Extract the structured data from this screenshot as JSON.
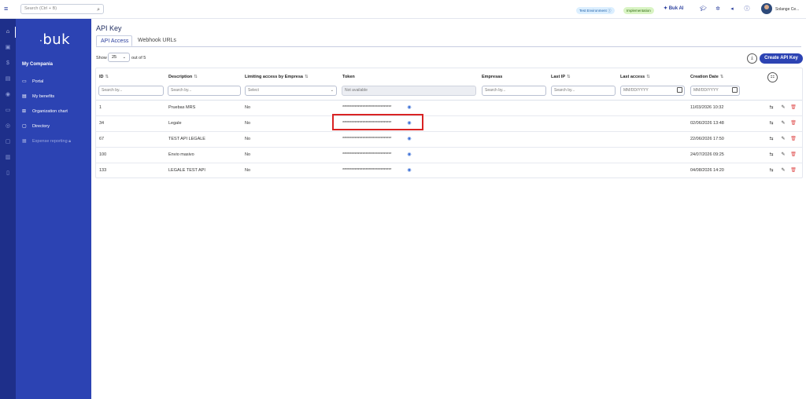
{
  "topbar": {
    "search_placeholder": "Search (Ctrl + B)",
    "env_badge": "Test Environment ⓘ",
    "impl_badge": "Implementation",
    "buk_ai": "✦ Buk AI",
    "user_name": "Solange Ce..."
  },
  "sidebar": {
    "logo": "buk",
    "company": "My Compania",
    "items": [
      {
        "label": "Portal",
        "icon": "monitor-icon"
      },
      {
        "label": "My benefits",
        "icon": "gift-icon"
      },
      {
        "label": "Organization chart",
        "icon": "org-chart-icon"
      },
      {
        "label": "Directory",
        "icon": "briefcase-icon"
      },
      {
        "label": "Expense reporting",
        "icon": "receipt-icon"
      }
    ]
  },
  "page": {
    "title": "API Key",
    "tabs": [
      "API Access",
      "Webhook URLs"
    ],
    "show_label": "Show",
    "show_value": "25",
    "out_of": "out of 5",
    "create_button": "Create API Key"
  },
  "table": {
    "headers": {
      "id": "ID",
      "description": "Description",
      "limiting": "Limiting access by Empresa",
      "token": "Token",
      "empresas": "Empresas",
      "last_ip": "Last IP",
      "last_access": "Last access",
      "creation_date": "Creation Date"
    },
    "filters": {
      "id": "Search by...",
      "description": "Search by...",
      "limiting": "Select",
      "token": "Not available",
      "empresas": "Search by...",
      "last_ip": "Search by...",
      "last_access": "MM/DD/YYYY",
      "creation_date": "MM/DD/YYYY"
    },
    "rows": [
      {
        "id": "1",
        "description": "Pruebas MRS",
        "limiting": "No",
        "token": "********************************",
        "creation_date": "11/03/2026 10:32"
      },
      {
        "id": "34",
        "description": "Legale",
        "limiting": "No",
        "token": "********************************",
        "creation_date": "02/06/2026 13:48"
      },
      {
        "id": "67",
        "description": "TEST API LEGALE",
        "limiting": "No",
        "token": "********************************",
        "creation_date": "22/06/2026 17:50"
      },
      {
        "id": "100",
        "description": "Envio masivo",
        "limiting": "No",
        "token": "********************************",
        "creation_date": "24/07/2026 09:25"
      },
      {
        "id": "133",
        "description": "LEGALE TEST API",
        "limiting": "No",
        "token": "********************************",
        "creation_date": "04/08/2026 14:20"
      }
    ]
  },
  "colors": {
    "brand": "#2c43b3",
    "rail": "#1e2f8a",
    "highlight": "#d92323",
    "delete": "#e05252"
  }
}
